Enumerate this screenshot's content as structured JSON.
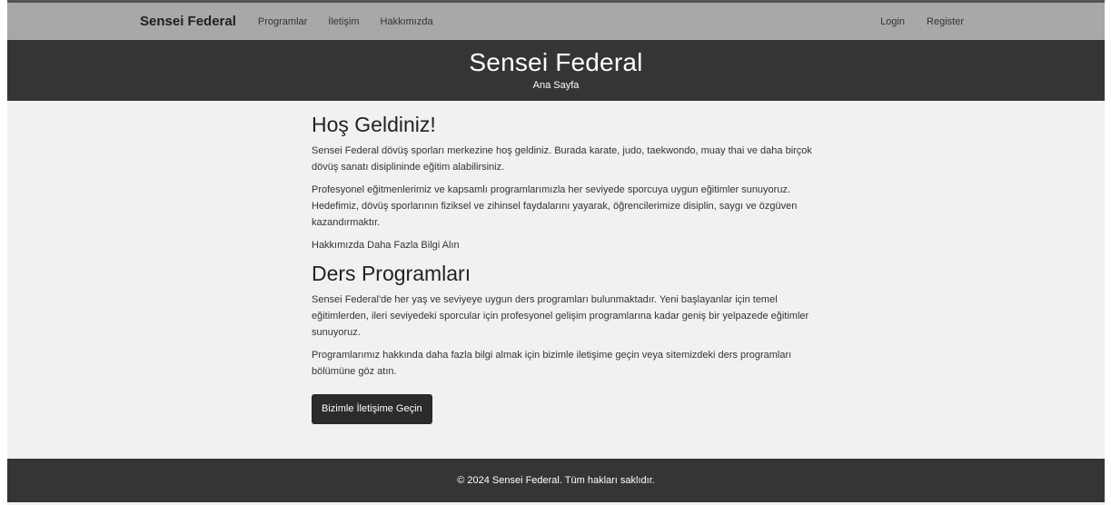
{
  "navbar": {
    "brand": "Sensei Federal",
    "links": [
      "Programlar",
      "İletişim",
      "Hakkımızda"
    ],
    "login": "Login",
    "register": "Register"
  },
  "hero": {
    "title": "Sensei Federal",
    "subtitle": "Ana Sayfa"
  },
  "welcome": {
    "heading": "Hoş Geldiniz!",
    "paragraph1": "Sensei Federal dövüş sporları merkezine hoş geldiniz. Burada karate, judo, taekwondo, muay thai ve daha birçok dövüş sanatı disiplininde eğitim alabilirsiniz.",
    "paragraph2": "Profesyonel eğitmenlerimiz ve kapsamlı programlarımızla her seviyede sporcuya uygun eğitimler sunuyoruz. Hedefimiz, dövüş sporlarının fiziksel ve zihinsel faydalarını yayarak, öğrencilerimize disiplin, saygı ve özgüven kazandırmaktır.",
    "more_link": "Hakkımızda Daha Fazla Bilgi Alın"
  },
  "programs": {
    "heading": "Ders Programları",
    "paragraph1": "Sensei Federal'de her yaş ve seviyeye uygun ders programları bulunmaktadır. Yeni başlayanlar için temel eğitimlerden, ileri seviyedeki sporcular için profesyonel gelişim programlarına kadar geniş bir yelpazede eğitimler sunuyoruz.",
    "paragraph2": "Programlarımız hakkında daha fazla bilgi almak için bizimle iletişime geçin veya sitemizdeki ders programları bölümüne göz atın.",
    "cta_label": "Bizimle İletişime Geçin"
  },
  "footer": {
    "text": "© 2024 Sensei Federal. Tüm hakları saklıdır."
  },
  "colors": {
    "navbar_bg": "#a8a8a8",
    "hero_bg": "#353535",
    "page_bg": "#f1f1f1",
    "button_bg": "#2b2b2b"
  }
}
